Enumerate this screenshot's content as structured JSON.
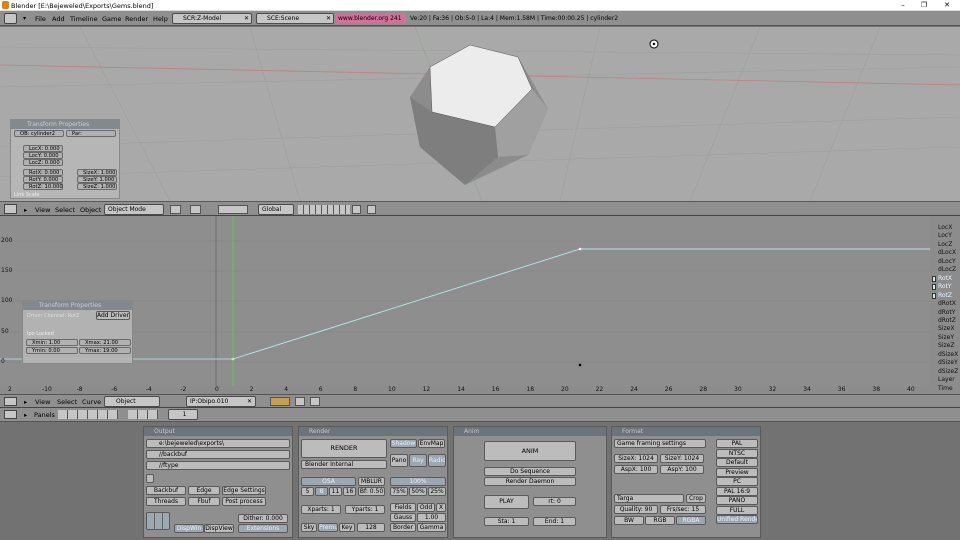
{
  "window": {
    "title": "Blender [E:\\Bejeweled\\Exports\\Gems.blend]",
    "min": "–",
    "max": "❐",
    "close": "✕"
  },
  "header": {
    "menus": [
      "File",
      "Add",
      "Timeline",
      "Game",
      "Render",
      "Help"
    ],
    "screen": "SCR:Z-Model",
    "scene": "SCE:Scene",
    "web": "www.blender.org 241",
    "stats": "Ve:20 | Fa:36 | Ob:5-0 | La:4 | Mem:1.58M | Time:00:00.25 | cylinder2"
  },
  "transform": {
    "title": "Transform Properties",
    "ob": "OB: cylinder2",
    "par": "Par:",
    "loc": [
      "LocX: 0.000",
      "LocY: 0.000",
      "LocZ: 0.000"
    ],
    "rot": [
      "RotX: 0.000",
      "RotY: 0.000",
      "RotZ: 10.000"
    ],
    "size": [
      "SizeX: 1.000",
      "SizeY: 1.000",
      "SizeZ: 1.000"
    ],
    "footer": "Link Scale"
  },
  "view3dhdr": {
    "menus": [
      "View",
      "Select",
      "Object"
    ],
    "mode": "Object Mode",
    "orient": "Global"
  },
  "ipo": {
    "yticks": [
      "200",
      "150",
      "100",
      "50",
      "0"
    ],
    "xticks": [
      "2",
      "-10",
      "-8",
      "-6",
      "-4",
      "-2",
      "0",
      "2",
      "4",
      "6",
      "8",
      "10",
      "12",
      "14",
      "16",
      "18",
      "20",
      "22",
      "24",
      "26",
      "28",
      "30",
      "32",
      "34",
      "36",
      "38",
      "40"
    ],
    "channels": [
      "LocX",
      "LocY",
      "LocZ",
      "dLocX",
      "dLocY",
      "dLocZ",
      "RotX",
      "RotY",
      "RotZ",
      "dRotX",
      "dRotY",
      "dRotZ",
      "SizeX",
      "SizeY",
      "SizeZ",
      "dSizeX",
      "dSizeY",
      "dSizeZ",
      "Layer",
      "Time"
    ],
    "float": {
      "title": "Transform Properties",
      "driver": "Driver Channel: RotZ",
      "add_driver": "Add Driver",
      "xmin": "Xmin: 1.00",
      "xmax": "Xmax: 21.00",
      "ymin": "Ymin: 0.00",
      "ymax": "Ymax: 19.00",
      "bottom": "Ipo Locked"
    }
  },
  "ipohdr": {
    "menus": [
      "View",
      "Select",
      "Curve"
    ],
    "type": "Object",
    "ipo": "IP:Obipo.010"
  },
  "btnhdr": {
    "panels": "Panels",
    "frame": "1"
  },
  "output": {
    "title": "Output",
    "paths": [
      "e:\\bejeweled\\exports\\",
      "//backbuf",
      "//ftype"
    ],
    "backbuf": "Backbuf",
    "edge": "Edge",
    "edge_settings": "Edge Settings",
    "threads": "Threads",
    "fbuf": "Fbuf",
    "post": "Post process",
    "dither": "Dither: 0.000",
    "dispwin": "DispWin",
    "dispview": "DispView",
    "ext": "Extensions"
  },
  "render": {
    "title": "Render",
    "render": "RENDER",
    "shadow": "Shadow",
    "envmap": "EnvMap",
    "pano": "Pano",
    "ray": "Ray",
    "radio": "Radio",
    "engine": "Blender Internal",
    "osa": "OSA",
    "mblur": "MBLUR",
    "pct": "100%",
    "osa_vals": [
      "5",
      "8",
      "11",
      "16"
    ],
    "bf": "Bf: 0.50",
    "pcts": [
      "75%",
      "50%",
      "25%"
    ],
    "xparts": "Xparts: 1",
    "yparts": "Yparts: 1",
    "fields": "Fields",
    "odd": "Odd",
    "x": "X",
    "gauss": "Gauss",
    "gauss_val": "1.00",
    "sky": "Sky",
    "premul": "Premul",
    "key": "Key",
    "key_val": "128",
    "border": "Border",
    "gamma": "Gamma"
  },
  "anim": {
    "title": "Anim",
    "anim": "ANIM",
    "doseq": "Do Sequence",
    "daemon": "Render Daemon",
    "play": "PLAY",
    "rt": "rt: 0",
    "sta": "Sta: 1",
    "end": "End: 1"
  },
  "format": {
    "title": "Format",
    "game": "Game framing settings",
    "sizex": "SizeX: 1024",
    "sizey": "SizeY: 1024",
    "aspx": "AspX: 100",
    "aspy": "AspY: 100",
    "targa": "Targa",
    "crop": "Crop",
    "quality": "Quality: 90",
    "fps": "Frs/sec: 15",
    "bw": "BW",
    "rgb": "RGB",
    "rgba": "RGBA",
    "presets": [
      "PAL",
      "NTSC",
      "Default",
      "Preview",
      "PC",
      "PAL 16:9",
      "PANO",
      "FULL",
      "Unified Render"
    ]
  },
  "colors": {
    "ipo_curve": "#b8e8e6",
    "current_frame": "#60d050",
    "grid_bg": "#a9a9a9"
  }
}
